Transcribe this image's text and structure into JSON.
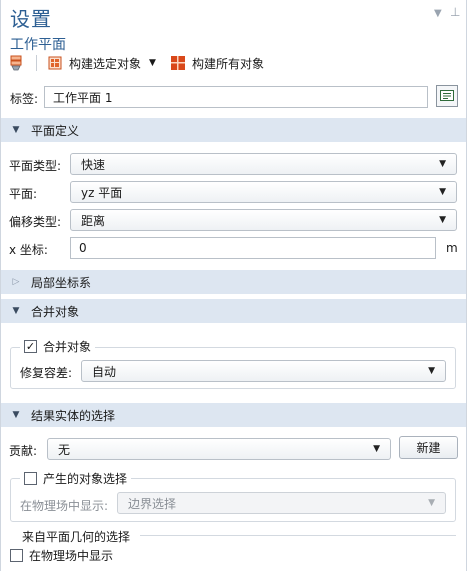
{
  "header": {
    "title": "设置",
    "subtitle": "工作平面",
    "pin_glyph": "▾ ⊥"
  },
  "toolbar": {
    "build_selected_label": "构建选定对象",
    "build_all_label": "构建所有对象"
  },
  "label_row": {
    "label": "标签:",
    "value": "工作平面 1"
  },
  "plane_definition": {
    "header": "平面定义",
    "plane_type": {
      "label": "平面类型:",
      "value": "快速"
    },
    "plane": {
      "label": "平面:",
      "value": "yz 平面"
    },
    "offset_type": {
      "label": "偏移类型:",
      "value": "距离"
    },
    "x_coord": {
      "label": "x 坐标:",
      "value": "0",
      "unit": "m"
    }
  },
  "local_coords": {
    "header": "局部坐标系"
  },
  "union": {
    "header": "合并对象",
    "checkbox_label": "合并对象",
    "checked": true,
    "repair_tolerance": {
      "label": "修复容差:",
      "value": "自动"
    }
  },
  "result_selection": {
    "header": "结果实体的选择",
    "contribute": {
      "label": "贡献:",
      "value": "无"
    },
    "new_button": "新建",
    "resulting_selection": {
      "label": "产生的对象选择",
      "checked": false
    },
    "show_in_physics": {
      "label": "在物理场中显示:",
      "value": "边界选择"
    }
  },
  "from_plane_geometry": {
    "legend": "来自平面几何的选择",
    "show_in_physics": {
      "label": "在物理场中显示",
      "checked": false
    }
  },
  "icons": {
    "build_selected": "build-selected-icon",
    "build_all": "build-all-icon",
    "label_edit": "edit-label-icon",
    "root": "work-plane-icon"
  },
  "colors": {
    "title": "#2d5f93",
    "section_bg": "#dde6f1",
    "build_icon": "#d9481a"
  }
}
